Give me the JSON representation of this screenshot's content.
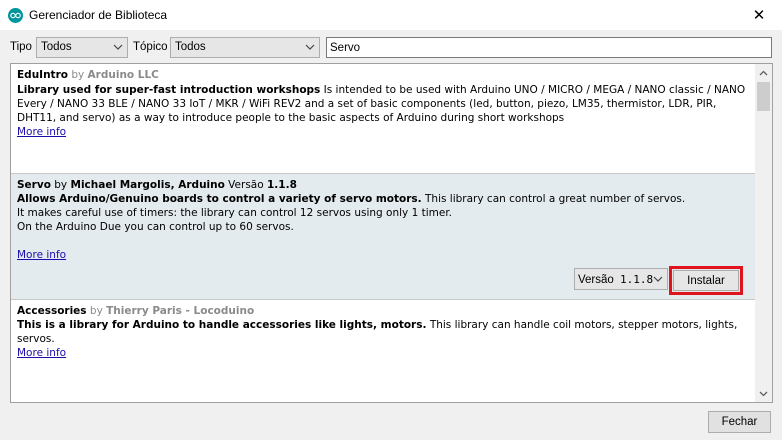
{
  "window": {
    "title": "Gerenciador de Biblioteca",
    "close_glyph": "✕"
  },
  "filters": {
    "type_label": "Tipo",
    "type_value": "Todos",
    "topic_label": "Tópico",
    "topic_value": "Todos",
    "search_value": "Servo"
  },
  "libraries": [
    {
      "name": "EduIntro",
      "by": "by",
      "author": "Arduino LLC",
      "sentence": "Library used for super-fast introduction workshops",
      "description": " Is intended to be used with Arduino UNO / MICRO / MEGA / NANO classic / NANO Every / NANO 33 BLE / NANO 33 IoT / MKR / WiFi REV2 and a set of basic components (led, button, piezo, LM35, thermistor, LDR, PIR, DHT11, and servo) as a way to introduce people to the basic aspects of Arduino during short workshops",
      "more_info": "More info"
    },
    {
      "name": "Servo",
      "by": "by",
      "author": "Michael Margolis, Arduino",
      "version_word": "Versão",
      "version": "1.1.8",
      "sentence": "Allows Arduino/Genuino boards to control a variety of servo motors.",
      "description": " This library can control a great number of servos.",
      "line2": "It makes careful use of timers: the library can control 12 servos using only 1 timer.",
      "line3": "On the Arduino Due you can control up to 60 servos.",
      "more_info": "More info",
      "version_select_label": "Versão",
      "version_select_value": "1.1.8",
      "install_label": "Instalar"
    },
    {
      "name": "Accessories",
      "by": "by",
      "author": "Thierry Paris - Locoduino",
      "sentence": "This is a library for Arduino to handle accessories like lights, motors.",
      "description": " This library can handle coil motors, stepper motors, lights, servos.",
      "more_info": "More info"
    }
  ],
  "footer": {
    "close_label": "Fechar"
  },
  "colors": {
    "highlight_border": "#e0141e",
    "selected_row": "#e4ebee",
    "link": "#1a0dab",
    "arduino_icon": "#00979c"
  }
}
